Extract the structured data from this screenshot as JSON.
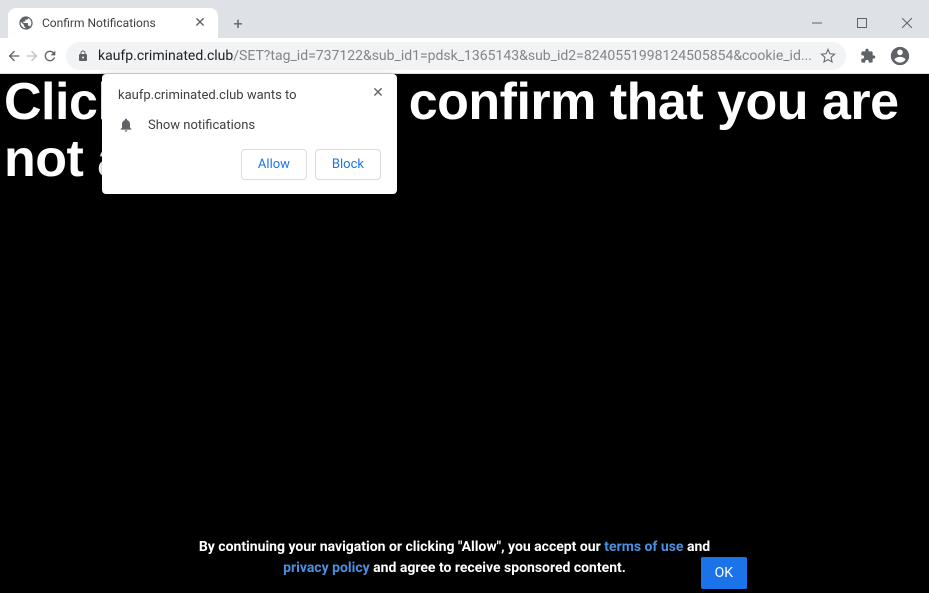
{
  "window": {
    "minimize": "—",
    "maximize": "☐",
    "close": "✕"
  },
  "tab": {
    "title": "Confirm Notifications"
  },
  "toolbar": {
    "url_host": "kaufp.criminated.club",
    "url_path": "/SET?tag_id=737122&sub_id1=pdsk_1365143&sub_id2=8240551998124505854&cookie_id..."
  },
  "permission": {
    "wants_to": "kaufp.criminated.club wants to",
    "show_notifications": "Show notifications",
    "allow": "Allow",
    "block": "Block"
  },
  "page": {
    "headline": "Click «Allow» to confirm that you are not a robot!"
  },
  "cookie": {
    "text_before": "By continuing your navigation or clicking \"Allow\", you accept our ",
    "terms": "terms of use",
    "and": " and ",
    "privacy": "privacy policy",
    "text_after": " and agree to receive sponsored content.",
    "ok": "OK"
  }
}
